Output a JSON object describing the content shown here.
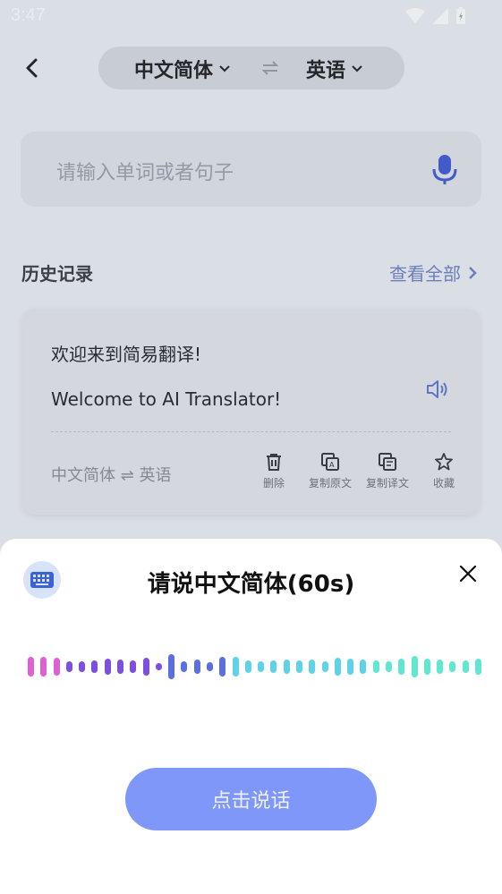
{
  "status": {
    "time": "3:47"
  },
  "header": {
    "source_lang": "中文简体",
    "target_lang": "英语"
  },
  "search": {
    "placeholder": "请输入单词或者句子"
  },
  "history": {
    "title": "历史记录",
    "view_all": "查看全部",
    "card": {
      "source_text": "欢迎来到简易翻译!",
      "target_text": "Welcome to AI Translator!",
      "lang_pair": "中文简体 ⇌ 英语",
      "actions": [
        "删除",
        "复制原文",
        "复制译文",
        "收藏"
      ]
    }
  },
  "voice_sheet": {
    "title": "请说中文简体(60s)",
    "button_label": "点击说话",
    "wave_colors": [
      "#e05fd2",
      "#7b4fe0",
      "#5b6fe0",
      "#5fd2e8",
      "#5fe8cf"
    ]
  }
}
